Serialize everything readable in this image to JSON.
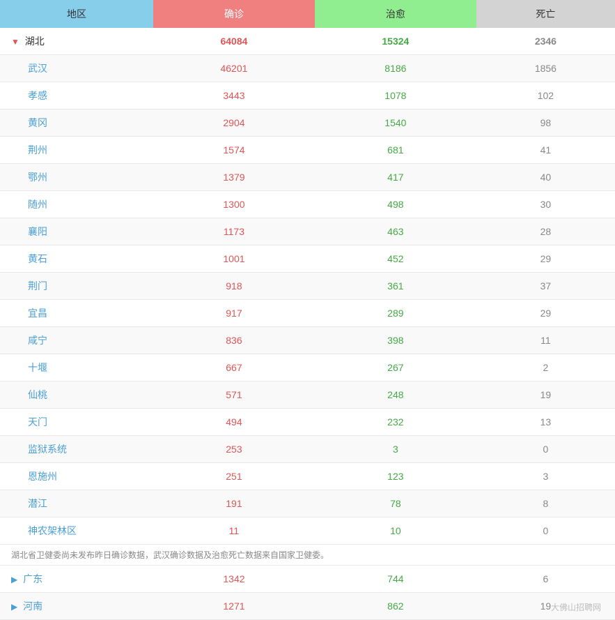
{
  "header": {
    "region": "地区",
    "confirm": "确诊",
    "recover": "治愈",
    "death": "死亡"
  },
  "hubei": {
    "name": "湖北",
    "confirm": "64084",
    "recover": "15324",
    "death": "2346",
    "children": [
      {
        "name": "武汉",
        "confirm": "46201",
        "recover": "8186",
        "death": "1856"
      },
      {
        "name": "孝感",
        "confirm": "3443",
        "recover": "1078",
        "death": "102"
      },
      {
        "name": "黄冈",
        "confirm": "2904",
        "recover": "1540",
        "death": "98"
      },
      {
        "name": "荆州",
        "confirm": "1574",
        "recover": "681",
        "death": "41"
      },
      {
        "name": "鄂州",
        "confirm": "1379",
        "recover": "417",
        "death": "40"
      },
      {
        "name": "随州",
        "confirm": "1300",
        "recover": "498",
        "death": "30"
      },
      {
        "name": "襄阳",
        "confirm": "1173",
        "recover": "463",
        "death": "28"
      },
      {
        "name": "黄石",
        "confirm": "1001",
        "recover": "452",
        "death": "29"
      },
      {
        "name": "荆门",
        "confirm": "918",
        "recover": "361",
        "death": "37"
      },
      {
        "name": "宜昌",
        "confirm": "917",
        "recover": "289",
        "death": "29"
      },
      {
        "name": "咸宁",
        "confirm": "836",
        "recover": "398",
        "death": "11"
      },
      {
        "name": "十堰",
        "confirm": "667",
        "recover": "267",
        "death": "2"
      },
      {
        "name": "仙桃",
        "confirm": "571",
        "recover": "248",
        "death": "19"
      },
      {
        "name": "天门",
        "confirm": "494",
        "recover": "232",
        "death": "13"
      },
      {
        "name": "监狱系统",
        "confirm": "253",
        "recover": "3",
        "death": "0"
      },
      {
        "name": "恩施州",
        "confirm": "251",
        "recover": "123",
        "death": "3"
      },
      {
        "name": "潜江",
        "confirm": "191",
        "recover": "78",
        "death": "8"
      },
      {
        "name": "神农架林区",
        "confirm": "11",
        "recover": "10",
        "death": "0"
      }
    ],
    "note": "湖北省卫健委尚未发布昨日确诊数据，武汉确诊数据及治愈死亡数据来自国家卫健委。"
  },
  "other_regions": [
    {
      "name": "广东",
      "confirm": "1342",
      "recover": "744",
      "death": "6"
    },
    {
      "name": "河南",
      "confirm": "1271",
      "recover": "862",
      "death": "19"
    }
  ],
  "watermark": "大佛山招聘网"
}
